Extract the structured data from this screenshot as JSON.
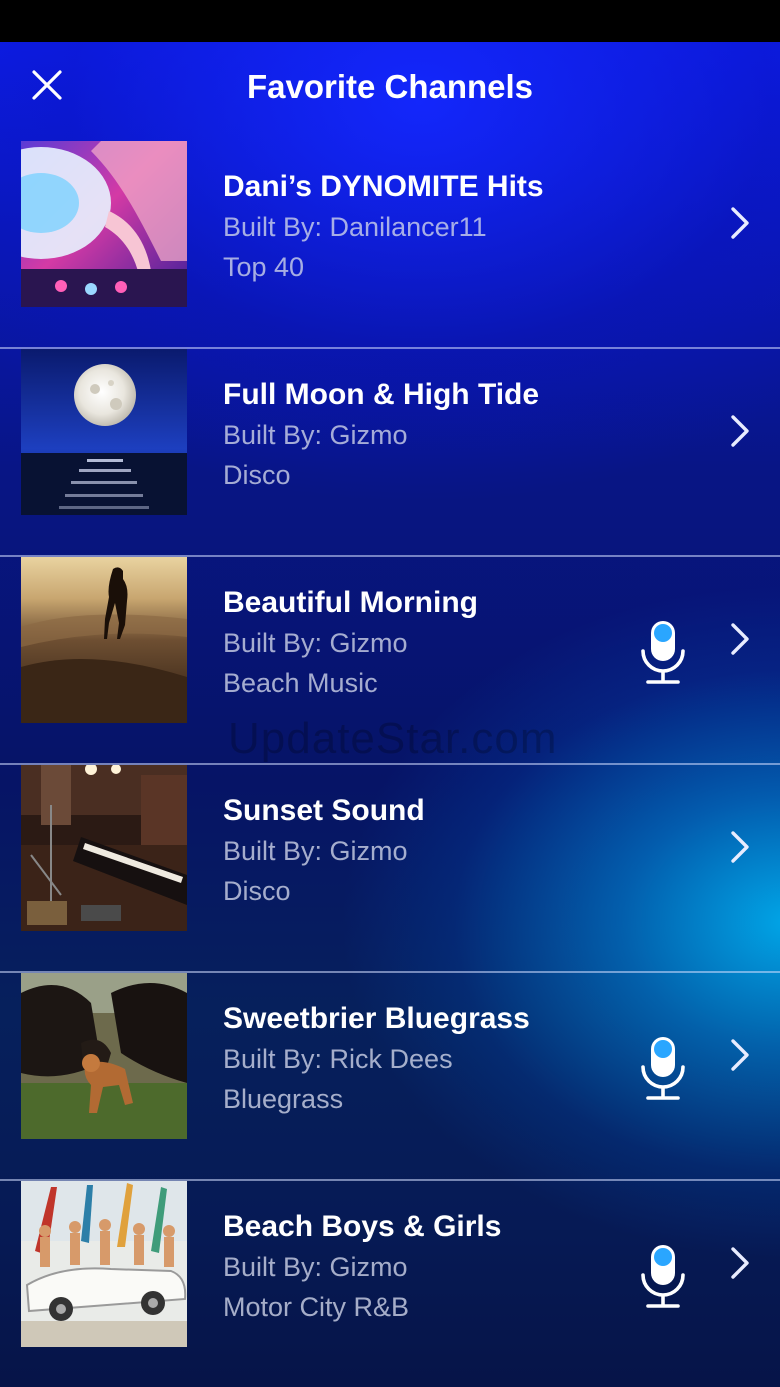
{
  "header": {
    "title": "Favorite Channels"
  },
  "channels": [
    {
      "name": "Dani’s DYNOMITE Hits",
      "builder": "Built By: Danilancer11",
      "genre": "Top 40",
      "mic": false
    },
    {
      "name": "Full Moon & High Tide",
      "builder": "Built By: Gizmo",
      "genre": "Disco",
      "mic": false
    },
    {
      "name": "Beautiful Morning",
      "builder": "Built By: Gizmo",
      "genre": "Beach Music",
      "mic": true
    },
    {
      "name": "Sunset Sound",
      "builder": "Built By: Gizmo",
      "genre": "Disco",
      "mic": false
    },
    {
      "name": "Sweetbrier Bluegrass",
      "builder": "Built By: Rick Dees",
      "genre": "Bluegrass",
      "mic": true
    },
    {
      "name": "Beach Boys & Girls",
      "builder": "Built By: Gizmo",
      "genre": "Motor City R&B",
      "mic": true
    }
  ],
  "icons": {
    "close": "close-icon",
    "chevron": "chevron-right-icon",
    "mic": "microphone-icon"
  },
  "colors": {
    "mic_accent": "#2aa6ff",
    "text_secondary": "#c8cde6"
  },
  "watermark": "UpdateStar.com"
}
